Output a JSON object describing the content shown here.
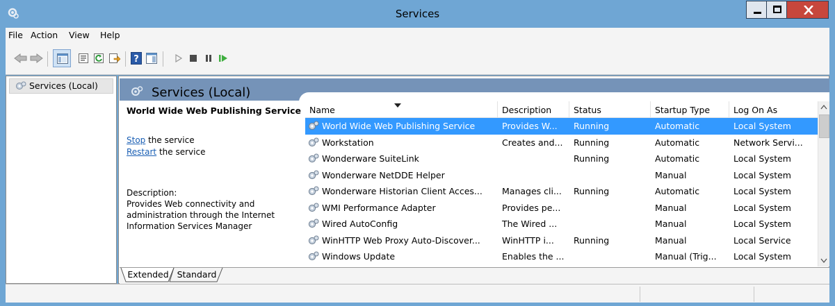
{
  "window": {
    "title": "Services",
    "accent": "#6fa6d4"
  },
  "menu": [
    {
      "label": "File"
    },
    {
      "label": "Action"
    },
    {
      "label": "View"
    },
    {
      "label": "Help"
    }
  ],
  "tree": {
    "label": "Services (Local)"
  },
  "header": {
    "title": "Services (Local)"
  },
  "details": {
    "service_name": "World Wide Web Publishing Service",
    "stop_link": "Stop",
    "stop_suffix": " the service",
    "restart_link": "Restart",
    "restart_suffix": " the service",
    "description_label": "Description:",
    "description_lines": [
      "Provides Web connectivity and",
      "administration through the Internet",
      "Information Services Manager"
    ]
  },
  "columns": [
    "Name",
    "Description",
    "Status",
    "Startup Type",
    "Log On As"
  ],
  "rows": [
    {
      "name": "World Wide Web Publishing Service",
      "description": "Provides W...",
      "status": "Running",
      "startup": "Automatic",
      "logon": "Local System",
      "selected": true
    },
    {
      "name": "Workstation",
      "description": "Creates and...",
      "status": "Running",
      "startup": "Automatic",
      "logon": "Network Servi..."
    },
    {
      "name": "Wonderware SuiteLink",
      "description": "",
      "status": "Running",
      "startup": "Automatic",
      "logon": "Local System"
    },
    {
      "name": "Wonderware NetDDE Helper",
      "description": "",
      "status": "",
      "startup": "Manual",
      "logon": "Local System"
    },
    {
      "name": "Wonderware Historian Client Acces...",
      "description": "Manages cli...",
      "status": "Running",
      "startup": "Automatic",
      "logon": "Local System"
    },
    {
      "name": "WMI Performance Adapter",
      "description": "Provides pe...",
      "status": "",
      "startup": "Manual",
      "logon": "Local System"
    },
    {
      "name": "Wired AutoConfig",
      "description": "The Wired ...",
      "status": "",
      "startup": "Manual",
      "logon": "Local System"
    },
    {
      "name": "WinHTTP Web Proxy Auto-Discover...",
      "description": "WinHTTP i...",
      "status": "Running",
      "startup": "Manual",
      "logon": "Local Service"
    },
    {
      "name": "Windows Update",
      "description": "Enables the ...",
      "status": "",
      "startup": "Manual (Trig...",
      "logon": "Local System"
    }
  ],
  "tabs": [
    {
      "label": "Extended",
      "active": true
    },
    {
      "label": "Standard",
      "active": false
    }
  ],
  "toolbar": {
    "icons": [
      "back-arrow-icon",
      "forward-arrow-icon",
      "show-console-tree-icon",
      "properties-icon",
      "refresh-icon",
      "export-list-icon",
      "help-icon",
      "show-action-pane-icon",
      "start-service-icon",
      "stop-service-icon",
      "pause-service-icon",
      "restart-service-icon"
    ]
  }
}
